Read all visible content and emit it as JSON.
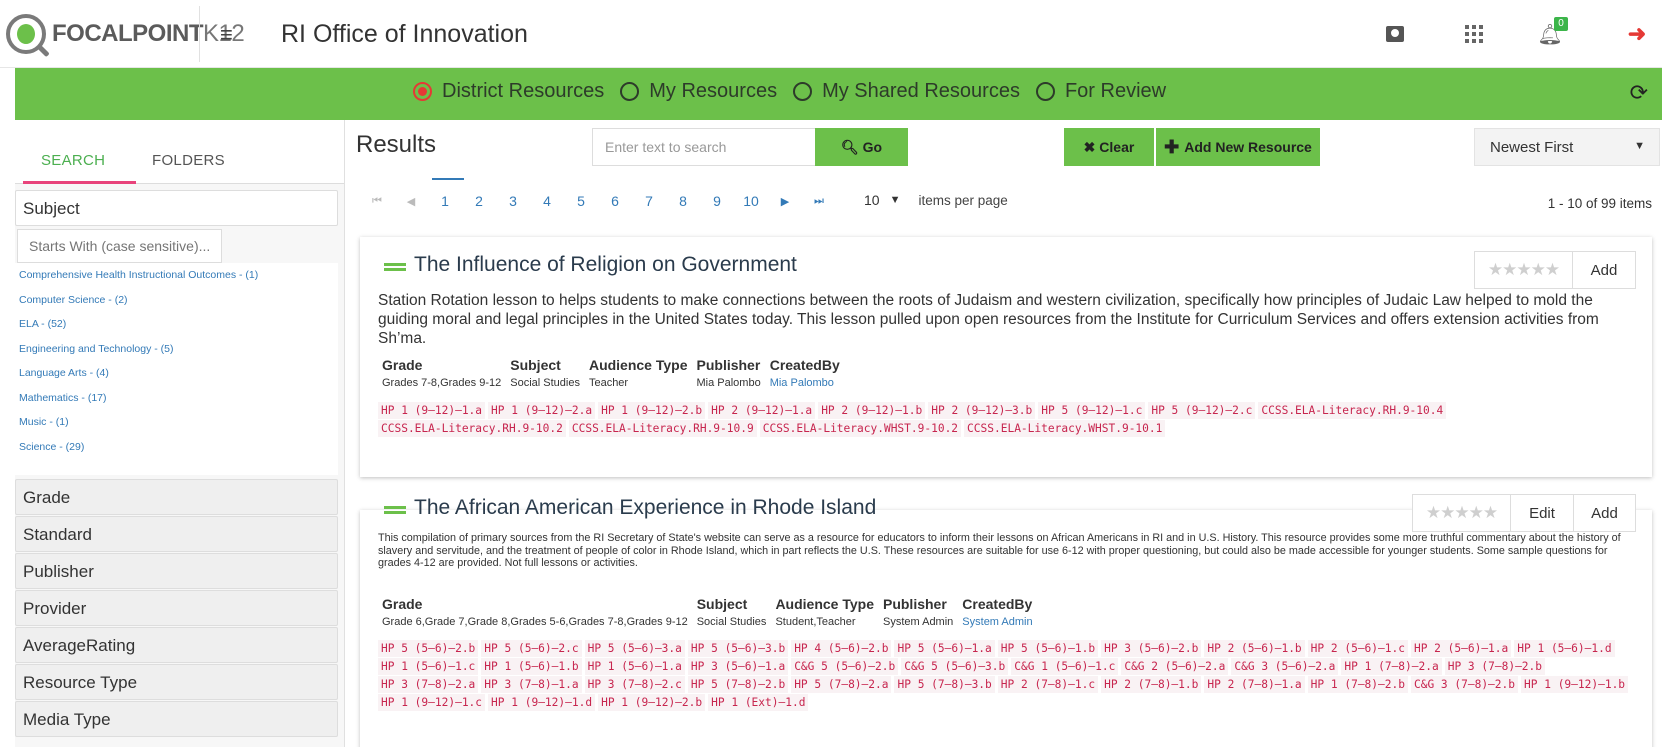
{
  "header": {
    "logo_main": "FOCALPOINT",
    "logo_k12": "K12",
    "title": "RI Office of Innovation",
    "notification_count": "0",
    "icons": [
      "contact-icon",
      "apps-grid-icon",
      "bell-icon",
      "logout-icon"
    ]
  },
  "resource_tabs": [
    {
      "label": "District Resources",
      "selected": true
    },
    {
      "label": "My Resources",
      "selected": false
    },
    {
      "label": "My Shared Resources",
      "selected": false
    },
    {
      "label": "For Review",
      "selected": false
    }
  ],
  "sidebar": {
    "tabs": {
      "search": "SEARCH",
      "folders": "FOLDERS"
    },
    "subject_facet": {
      "title": "Subject",
      "filter_placeholder": "Starts With (case sensitive)...",
      "items": [
        "Comprehensive Health Instructional Outcomes - (1)",
        "Computer Science - (2)",
        "ELA - (52)",
        "Engineering and Technology - (5)",
        "Language Arts - (4)",
        "Mathematics - (17)",
        "Music - (1)",
        "Science - (29)"
      ]
    },
    "facets": [
      "Grade",
      "Standard",
      "Publisher",
      "Provider",
      "AverageRating",
      "Resource Type",
      "Media Type"
    ]
  },
  "results": {
    "title": "Results",
    "search_placeholder": "Enter text to search",
    "go_label": "Go",
    "clear_label": "Clear",
    "add_new_label": "Add New Resource",
    "sort_label": "Newest First",
    "pages": [
      "1",
      "2",
      "3",
      "4",
      "5",
      "6",
      "7",
      "8",
      "9",
      "10"
    ],
    "page_size": "10",
    "per_page_label": "items per page",
    "count_label": "1 - 10 of 99 items"
  },
  "cards": [
    {
      "title": "The Influence of Religion on Government",
      "stars": "★★★★★",
      "actions": [
        "Add"
      ],
      "description": "Station Rotation lesson to helps students to make connections between the roots of Judaism and western civilization, specifically how principles of Judaic Law helped to mold the guiding moral and legal principles in the United States today. This lesson pulled upon open resources from the Institute for Curriculum Services and offers extension activities from Sh’ma.",
      "meta_labels": {
        "grade": "Grade",
        "subject": "Subject",
        "audience": "Audience Type",
        "publisher": "Publisher",
        "created_by": "CreatedBy"
      },
      "grade": "Grades 7-8,Grades 9-12",
      "subject": "Social Studies",
      "audience": "Teacher",
      "publisher": "Mia Palombo",
      "created_by": "Mia Palombo",
      "tags": [
        "HP 1 (9–12)–1.a",
        "HP 1 (9–12)–2.a",
        "HP 1 (9–12)–2.b",
        "HP 2 (9–12)–1.a",
        "HP 2 (9–12)–1.b",
        "HP 2 (9–12)–3.b",
        "HP 5 (9–12)–1.c",
        "HP 5 (9–12)–2.c",
        "CCSS.ELA-Literacy.RH.9-10.4",
        "CCSS.ELA-Literacy.RH.9-10.2",
        "CCSS.ELA-Literacy.RH.9-10.9",
        "CCSS.ELA-Literacy.WHST.9-10.2",
        "CCSS.ELA-Literacy.WHST.9-10.1"
      ]
    },
    {
      "title": "The African American Experience in Rhode Island",
      "stars": "★★★★★",
      "actions": [
        "Edit",
        "Add"
      ],
      "description": "This compilation of primary sources from the RI Secretary of State's website can serve as a resource for educators to inform their lessons on African Americans in RI and in U.S. History. This resource provides some more truthful commentary about the history of slavery and servitude, and the treatment of people of color in Rhode Island, which in part reflects the U.S. These resources are suitable for use 6-12 with proper questioning, but could also be made accessible for younger students. Some sample questions for grades 4-12 are provided. Not full lessons or activities.",
      "meta_labels": {
        "grade": "Grade",
        "subject": "Subject",
        "audience": "Audience Type",
        "publisher": "Publisher",
        "created_by": "CreatedBy"
      },
      "grade": "Grade 6,Grade 7,Grade 8,Grades 5-6,Grades 7-8,Grades 9-12",
      "subject": "Social Studies",
      "audience": "Student,Teacher",
      "publisher": "System Admin",
      "created_by": "System Admin",
      "tags": [
        "HP 5 (5–6)–2.b",
        "HP 5 (5–6)–2.c",
        "HP 5 (5–6)–3.a",
        "HP 5 (5–6)–3.b",
        "HP 4 (5–6)–2.b",
        "HP 5 (5–6)–1.a",
        "HP 5 (5–6)–1.b",
        "HP 3 (5–6)–2.b",
        "HP 2 (5–6)–1.b",
        "HP 2 (5–6)–1.c",
        "HP 2 (5–6)–1.a",
        "HP 1 (5–6)–1.d",
        "HP 1 (5–6)–1.c",
        "HP 1 (5–6)–1.b",
        "HP 1 (5–6)–1.a",
        "HP 3 (5–6)–1.a",
        "C&G 5 (5–6)–2.b",
        "C&G 5 (5–6)–3.b",
        "C&G 1 (5–6)–1.c",
        "C&G 2 (5–6)–2.a",
        "C&G 3 (5–6)–2.a",
        "HP 1 (7–8)–2.a",
        "HP 3 (7–8)–2.b",
        "HP 3 (7–8)–2.a",
        "HP 3 (7–8)–1.a",
        "HP 3 (7–8)–2.c",
        "HP 5 (7–8)–2.b",
        "HP 5 (7–8)–2.a",
        "HP 5 (7–8)–3.b",
        "HP 2 (7–8)–1.c",
        "HP 2 (7–8)–1.b",
        "HP 2 (7–8)–1.a",
        "HP 1 (7–8)–2.b",
        "C&G 3 (7–8)–2.b",
        "HP 1 (9–12)–1.b",
        "HP 1 (9–12)–1.c",
        "HP 1 (9–12)–1.d",
        "HP 1 (9–12)–2.b",
        "HP 1 (Ext)–1.d"
      ]
    }
  ]
}
